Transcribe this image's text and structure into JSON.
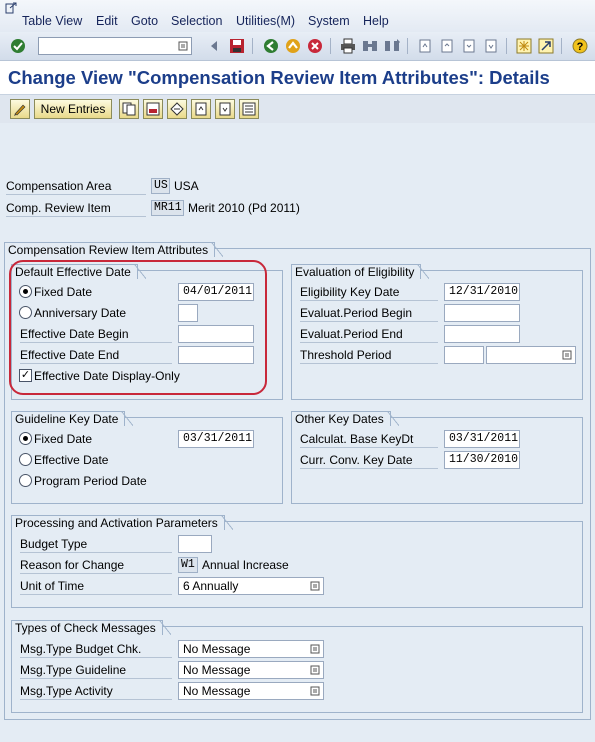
{
  "menu": [
    "Table View",
    "Edit",
    "Goto",
    "Selection",
    "Utilities(M)",
    "System",
    "Help"
  ],
  "title": "Change View \"Compensation Review Item Attributes\": Details",
  "app_toolbar": {
    "new_entries": "New Entries"
  },
  "header": {
    "comp_area_label": "Compensation Area",
    "comp_area_code": "US",
    "comp_area_text": "USA",
    "review_item_label": "Comp. Review Item",
    "review_item_code": "MR11",
    "review_item_text": "Merit 2010 (Pd 2011)"
  },
  "attributes_group": {
    "title": "Compensation Review Item Attributes"
  },
  "default_effective": {
    "title": "Default Effective Date",
    "fixed_date_label": "Fixed Date",
    "fixed_date_value": "04/01/2011",
    "anniversary_label": "Anniversary Date",
    "begin_label": "Effective Date Begin",
    "end_label": "Effective Date End",
    "display_only_label": "Effective Date Display-Only",
    "display_only_checked": true,
    "selected": "fixed"
  },
  "eligibility": {
    "title": "Evaluation of Eligibility",
    "key_date_label": "Eligibility Key Date",
    "key_date_value": "12/31/2010",
    "period_begin_label": "Evaluat.Period Begin",
    "period_end_label": "Evaluat.Period End",
    "threshold_label": "Threshold Period"
  },
  "guideline": {
    "title": "Guideline Key Date",
    "fixed_date_label": "Fixed Date",
    "fixed_date_value": "03/31/2011",
    "effective_label": "Effective Date",
    "program_label": "Program Period Date",
    "selected": "fixed"
  },
  "other_dates": {
    "title": "Other Key Dates",
    "calc_base_label": "Calculat. Base KeyDt",
    "calc_base_value": "03/31/2011",
    "curr_conv_label": "Curr. Conv. Key Date",
    "curr_conv_value": "11/30/2010"
  },
  "processing": {
    "title": "Processing and Activation Parameters",
    "budget_type_label": "Budget Type",
    "reason_label": "Reason for Change",
    "reason_code": "W1",
    "reason_text": "Annual Increase",
    "unit_label": "Unit of Time",
    "unit_value": "6 Annually"
  },
  "check_messages": {
    "title": "Types of  Check Messages",
    "budget_label": "Msg.Type Budget Chk.",
    "budget_value": "No Message",
    "guideline_label": "Msg.Type Guideline",
    "guideline_value": "No Message",
    "activity_label": "Msg.Type Activity",
    "activity_value": "No Message"
  },
  "colors": {
    "title": "#1c3e8a",
    "highlight": "#c8283a",
    "frame": "#9fb3cb"
  }
}
